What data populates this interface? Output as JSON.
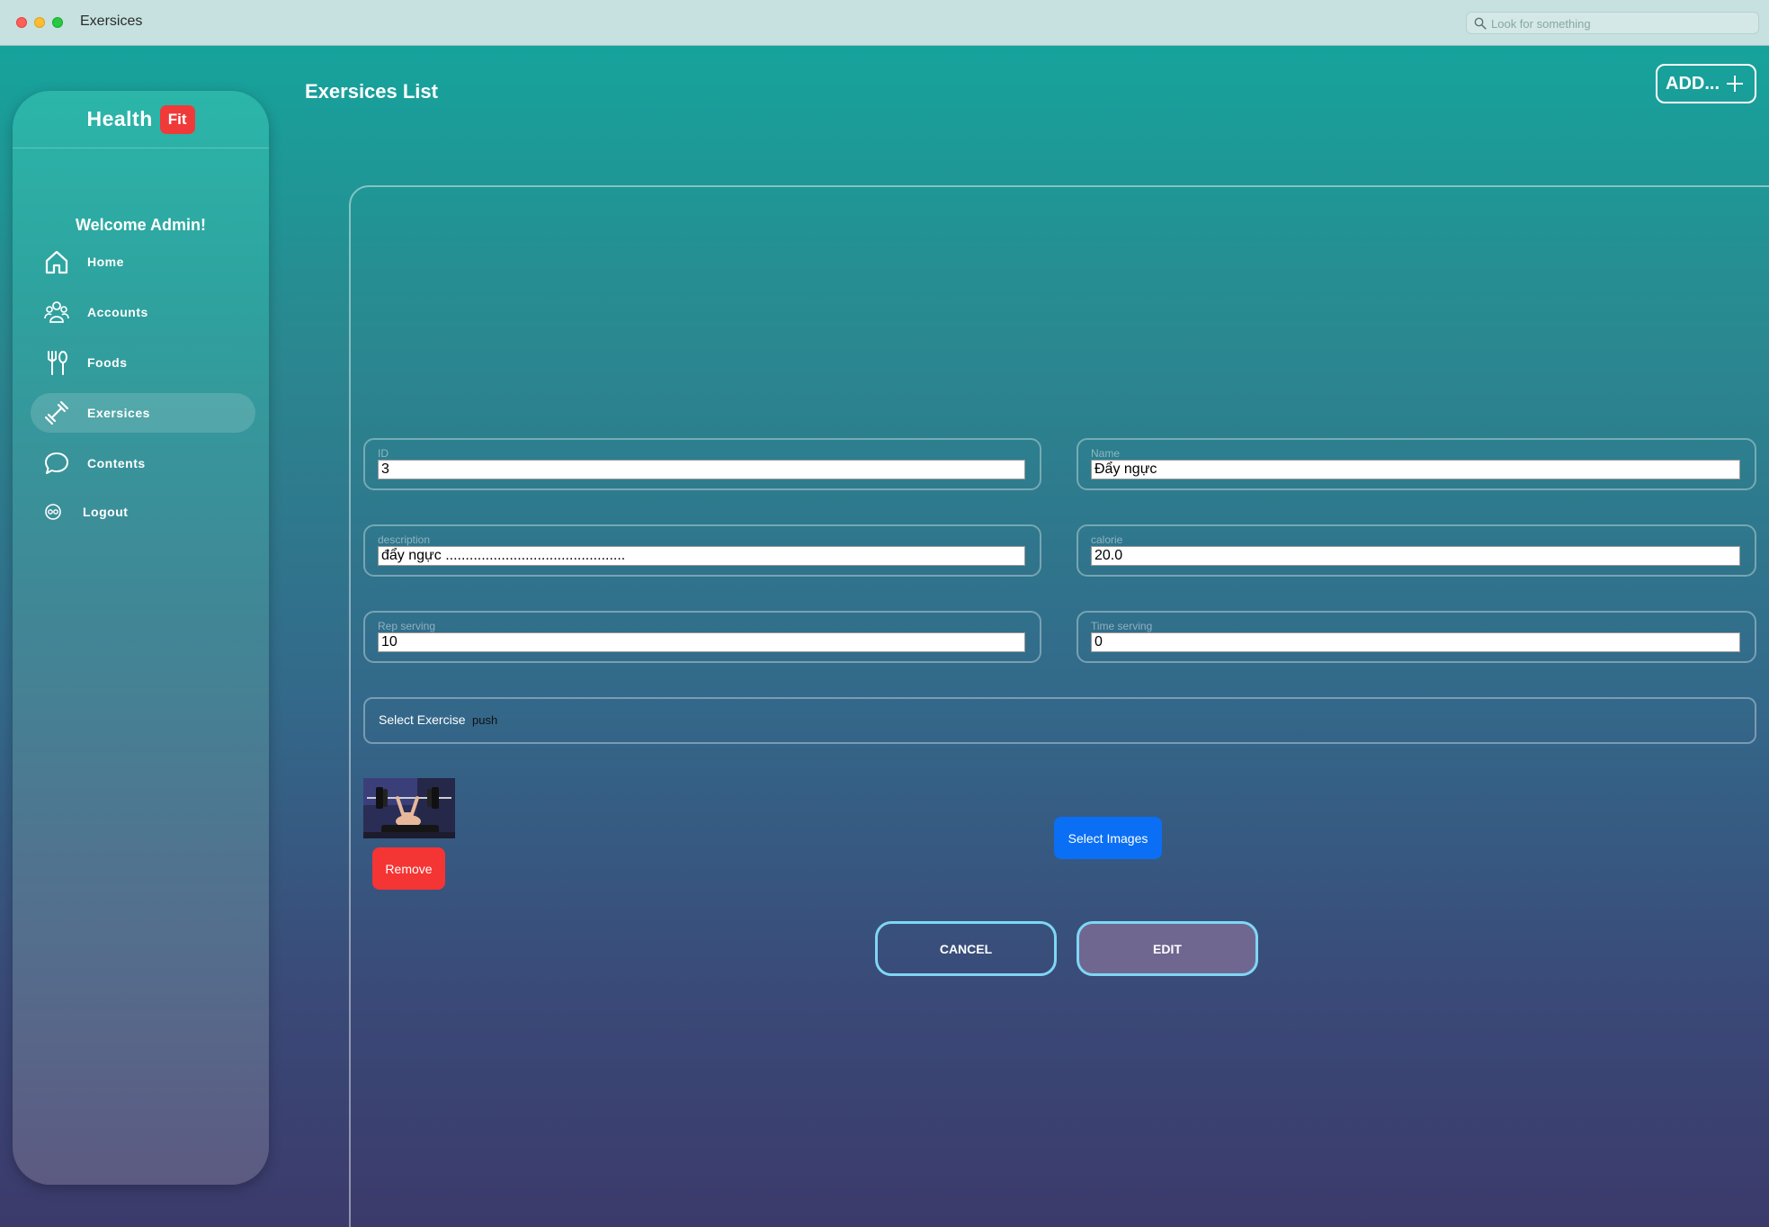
{
  "window": {
    "title": "Exersices",
    "search_placeholder": "Look for something"
  },
  "brand": {
    "name": "Health",
    "badge": "Fit"
  },
  "sidebar": {
    "welcome": "Welcome Admin!",
    "items": [
      {
        "label": "Home",
        "icon": "home-icon"
      },
      {
        "label": "Accounts",
        "icon": "accounts-icon"
      },
      {
        "label": "Foods",
        "icon": "fork-knife-icon"
      },
      {
        "label": "Exersices",
        "icon": "dumbbell-icon",
        "active": true
      },
      {
        "label": "Contents",
        "icon": "chat-bubble-icon"
      },
      {
        "label": "Logout",
        "icon": "logout-icon"
      }
    ]
  },
  "header": {
    "title": "Exersices List",
    "add_label": "ADD..."
  },
  "form": {
    "id": {
      "label": "ID",
      "value": "3"
    },
    "name": {
      "label": "Name",
      "value": "Đẩy ngực"
    },
    "description": {
      "label": "description",
      "value": "đẩy ngực ............................................."
    },
    "calorie": {
      "label": "calorie",
      "value": "20.0"
    },
    "rep_serving": {
      "label": "Rep serving",
      "value": "10"
    },
    "time_serving": {
      "label": "Time serving",
      "value": "0"
    },
    "select_exercise": {
      "label": "Select Exercise",
      "value": "push"
    }
  },
  "buttons": {
    "remove": "Remove",
    "select_images": "Select Images",
    "cancel": "CANCEL",
    "edit": "EDIT"
  },
  "colors": {
    "accent": "#0a6ff5",
    "danger": "#f53434",
    "brand_badge": "#f03a3a",
    "button_border": "#7fd6f5"
  }
}
